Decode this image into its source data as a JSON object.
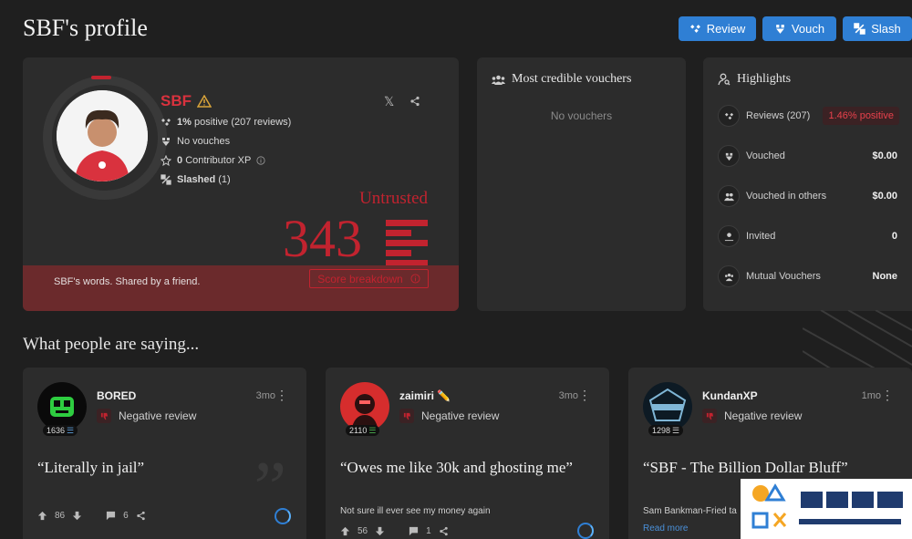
{
  "page": {
    "title": "SBF's profile"
  },
  "header_buttons": [
    {
      "label": "Review",
      "icon": "review-icon"
    },
    {
      "label": "Vouch",
      "icon": "vouch-icon"
    },
    {
      "label": "Slash",
      "icon": "slash-icon"
    }
  ],
  "profile": {
    "name": "SBF",
    "stats": {
      "reviews": {
        "bold": "1%",
        "rest": "positive (207 reviews)"
      },
      "vouches": "No vouches",
      "xp": {
        "bold": "0",
        "rest": "Contributor XP"
      },
      "slashed": {
        "bold": "Slashed",
        "rest": "(1)"
      }
    },
    "status": "Untrusted",
    "score": "343",
    "quote": "SBF's words. Shared by a friend.",
    "score_breakdown": "Score breakdown",
    "colors": {
      "danger": "#c2232f",
      "accent": "#2f7fd4"
    }
  },
  "vouchers": {
    "title": "Most credible vouchers",
    "empty": "No vouchers"
  },
  "highlights": {
    "title": "Highlights",
    "rows": [
      {
        "label": "Reviews (207)",
        "value": "1.46% positive",
        "icon": "reviews-icon"
      },
      {
        "label": "Vouched",
        "value": "$0.00",
        "icon": "vouch-icon"
      },
      {
        "label": "Vouched in others",
        "value": "$0.00",
        "icon": "people-icon"
      },
      {
        "label": "Invited",
        "value": "0",
        "icon": "invite-icon"
      },
      {
        "label": "Mutual Vouchers",
        "value": "None",
        "icon": "group-icon"
      }
    ]
  },
  "section": {
    "title": "What people are saying..."
  },
  "reviews": [
    {
      "name": "BORED",
      "xp": "1636",
      "time": "3mo",
      "type": "Negative review",
      "quote": "“Literally in jail”",
      "sub": "",
      "up": "86",
      "comments": "6",
      "read_more": ""
    },
    {
      "name": "zaimiri ✏️",
      "xp": "2110",
      "time": "3mo",
      "type": "Negative review",
      "quote": "“Owes me like 30k and ghosting me”",
      "sub": "Not sure ill ever see my money again",
      "up": "56",
      "comments": "1",
      "read_more": ""
    },
    {
      "name": "KundanXP",
      "xp": "1298",
      "time": "1mo",
      "type": "Negative review",
      "quote": "“SBF - The Billion Dollar Bluff”",
      "sub": "Sam Bankman-Fried ta",
      "up": "",
      "comments": "",
      "read_more": "Read more"
    }
  ]
}
